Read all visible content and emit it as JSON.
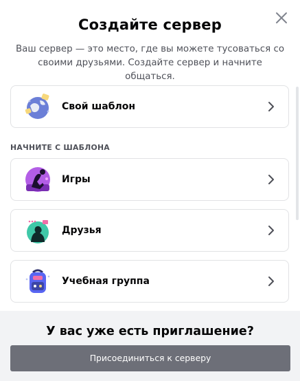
{
  "modal": {
    "title": "Создайте сервер",
    "subtitle": "Ваш сервер — это место, где вы можете тусоваться со своими друзьями. Создайте сервер и начните общаться."
  },
  "own_template": {
    "label": "Свой шаблон",
    "icon": "globe-icon"
  },
  "section_label": "НАЧНИТЕ С ШАБЛОНА",
  "templates": [
    {
      "label": "Игры",
      "icon": "gaming-icon"
    },
    {
      "label": "Друзья",
      "icon": "friends-icon"
    },
    {
      "label": "Учебная группа",
      "icon": "backpack-icon"
    }
  ],
  "footer": {
    "title": "У вас уже есть приглашение?",
    "join_label": "Присоединиться к серверу"
  },
  "colors": {
    "border": "#e1e2e4",
    "footer_bg": "#f2f3f5",
    "button_bg": "#6d6f78",
    "subtitle": "#4e5058"
  }
}
